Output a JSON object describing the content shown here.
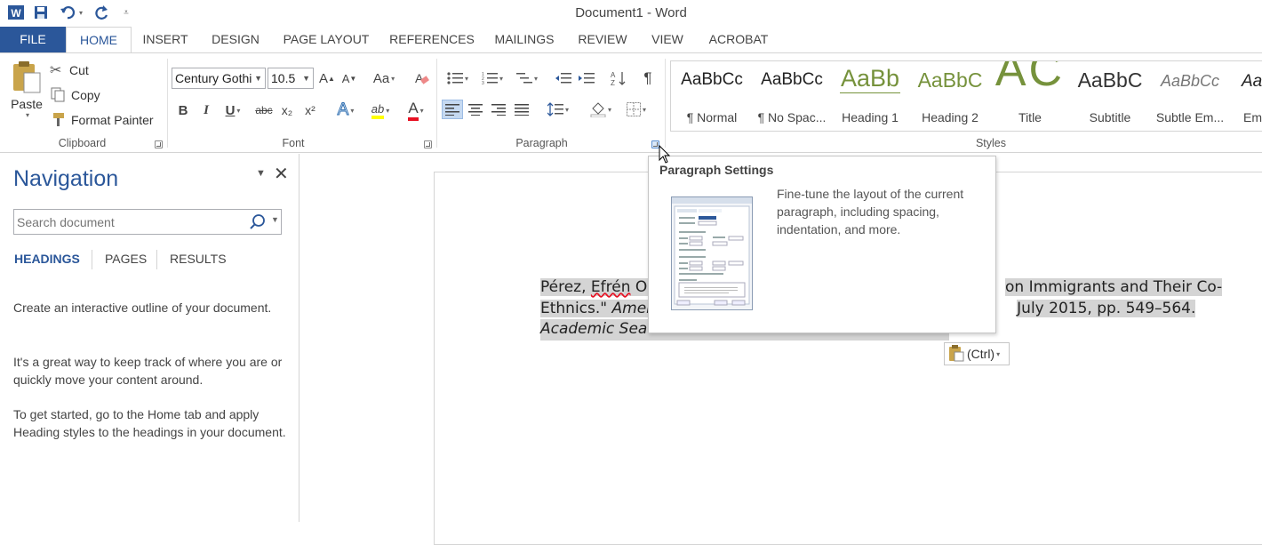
{
  "window": {
    "title": "Document1 - Word"
  },
  "colors": {
    "accent": "#2b579a",
    "heading_green": "#76923c",
    "highlight": "#d4d4d4",
    "font_red": "#e81123",
    "highlight_yellow": "#ffff00"
  },
  "tabs": [
    "FILE",
    "HOME",
    "INSERT",
    "DESIGN",
    "PAGE LAYOUT",
    "REFERENCES",
    "MAILINGS",
    "REVIEW",
    "VIEW",
    "ACROBAT"
  ],
  "clipboard": {
    "paste": "Paste",
    "cut": "Cut",
    "copy": "Copy",
    "format_painter": "Format Painter",
    "label": "Clipboard"
  },
  "font": {
    "name": "Century Gothi",
    "size": "10.5",
    "label": "Font",
    "bold": "B",
    "italic": "I",
    "underline": "U",
    "strike": "abc",
    "subscript": "x₂",
    "superscript": "x²"
  },
  "paragraph": {
    "label": "Paragraph"
  },
  "styles": {
    "label": "Styles",
    "items": [
      {
        "sample": "AaBbCc",
        "name": "¶ Normal"
      },
      {
        "sample": "AaBbCc",
        "name": "¶ No Spac..."
      },
      {
        "sample": "AaBb",
        "name": "Heading 1"
      },
      {
        "sample": "AaBbC",
        "name": "Heading 2"
      },
      {
        "sample": "AC",
        "name": "Title"
      },
      {
        "sample": "AaBbC",
        "name": "Subtitle"
      },
      {
        "sample": "AaBbCc",
        "name": "Subtle Em..."
      },
      {
        "sample": "Aa",
        "name": "Em"
      }
    ]
  },
  "nav": {
    "title": "Navigation",
    "search_placeholder": "Search document",
    "tabs": [
      "HEADINGS",
      "PAGES",
      "RESULTS"
    ],
    "p1": "Create an interactive outline of your document.",
    "p2": "It's a great way to keep track of where you are or quickly move your content around.",
    "p3": "To get started, go to the Home tab and apply Heading styles to the headings in your document."
  },
  "document": {
    "line1_a": "Pérez, ",
    "line1_b": "Efrén",
    "line1_c": " O.",
    "line1_tail": "on Immigrants and Their Co-",
    "line2_a": "Ethnics.\" ",
    "line2_b": "Amer",
    "line2_tail": "July 2015, pp. 549–564.",
    "line3": "Academic Sea"
  },
  "paste_options": {
    "label": "(Ctrl)"
  },
  "tooltip": {
    "title": "Paragraph Settings",
    "description": "Fine-tune the layout of the current paragraph, including spacing, indentation, and more."
  }
}
